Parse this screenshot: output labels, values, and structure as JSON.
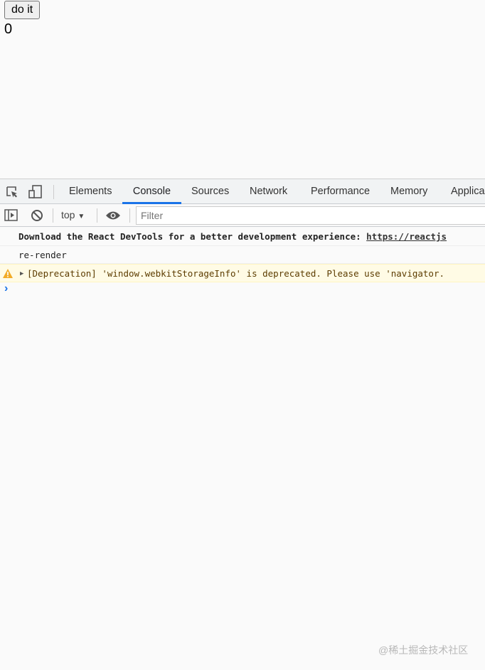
{
  "page": {
    "button_label": "do it",
    "count": "0"
  },
  "devtools": {
    "tabs": [
      "Elements",
      "Console",
      "Sources",
      "Network",
      "Performance",
      "Memory",
      "Applica"
    ],
    "active_tab": "Console",
    "context": "top",
    "filter_placeholder": "Filter",
    "messages": [
      {
        "text": "Download the React DevTools for a better development experience: ",
        "link": "https://reactjs"
      },
      {
        "text": "re-render"
      },
      {
        "level": "warning",
        "text": "[Deprecation] 'window.webkitStorageInfo' is deprecated. Please use 'navigator."
      }
    ],
    "prompt": "›"
  },
  "watermark": "@稀土掘金技术社区",
  "colors": {
    "accent": "#1a73e8",
    "warning_bg": "#fffbe5",
    "warning_icon": "#f2ab26"
  }
}
